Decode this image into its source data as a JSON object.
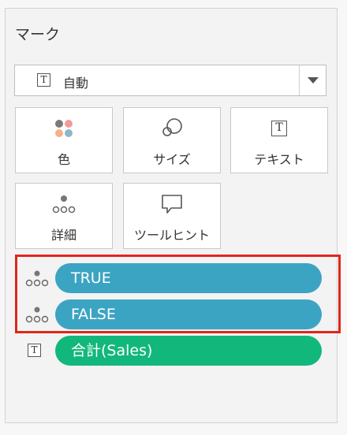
{
  "colors": {
    "pill_blue": "#3ca4c3",
    "pill_green": "#12b77c",
    "highlight": "#e0261a"
  },
  "marks": {
    "title": "マーク",
    "dropdown": {
      "icon": "text-icon",
      "icon_glyph": "T",
      "value": "自動"
    },
    "buttons": [
      {
        "icon": "color-icon",
        "label": "色"
      },
      {
        "icon": "size-icon",
        "label": "サイズ"
      },
      {
        "icon": "text-icon",
        "icon_glyph": "T",
        "label": "テキスト"
      },
      {
        "icon": "detail-icon",
        "label": "詳細"
      },
      {
        "icon": "tooltip-icon",
        "label": "ツールヒント"
      }
    ],
    "fields": [
      {
        "icon": "detail-icon",
        "label": "TRUE"
      },
      {
        "icon": "detail-icon",
        "label": "FALSE"
      },
      {
        "icon": "text-icon",
        "icon_glyph": "T",
        "label": "合計(Sales)"
      }
    ]
  }
}
